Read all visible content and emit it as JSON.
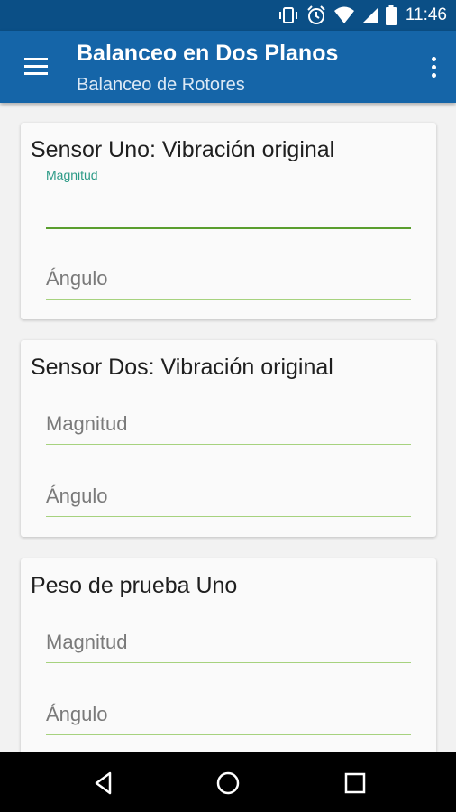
{
  "status_bar": {
    "time": "11:46",
    "icons": [
      "vibrate-icon",
      "alarm-icon",
      "wifi-icon",
      "signal-icon",
      "battery-icon"
    ]
  },
  "app_bar": {
    "title": "Balanceo en Dos Planos",
    "subtitle": "Balanceo de Rotores",
    "menu_icon": "hamburger-menu-icon",
    "overflow_icon": "more-vert-icon"
  },
  "cards": [
    {
      "title": "Sensor Uno: Vibración original",
      "fields": [
        {
          "label": "Magnitud",
          "value": "",
          "focused": true
        },
        {
          "label": "Ángulo",
          "value": ""
        }
      ]
    },
    {
      "title": "Sensor Dos: Vibración original",
      "fields": [
        {
          "label": "Magnitud",
          "value": ""
        },
        {
          "label": "Ángulo",
          "value": ""
        }
      ]
    },
    {
      "title": "Peso de prueba Uno",
      "fields": [
        {
          "label": "Magnitud",
          "value": ""
        },
        {
          "label": "Ángulo",
          "value": ""
        }
      ]
    }
  ],
  "nav_bar": {
    "icons": [
      "back-icon",
      "home-icon",
      "recents-icon"
    ]
  },
  "colors": {
    "status_bar": "#0b4f86",
    "app_bar": "#1565a8",
    "field_focus_label": "#2b9a86",
    "field_line": "#a6d27e",
    "field_line_focused": "#5a9e2e"
  }
}
